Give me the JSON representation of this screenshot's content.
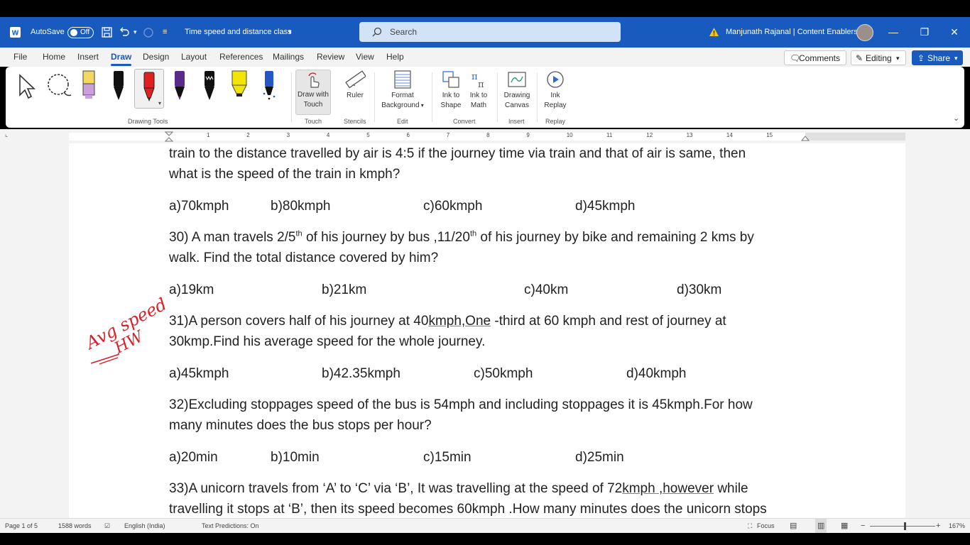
{
  "titlebar": {
    "autosave_label": "AutoSave",
    "autosave_state": "Off",
    "doc_title": "Time speed and distance class",
    "search_placeholder": "Search",
    "user_name": "Manjunath Rajanal | Content Enablers"
  },
  "menu": {
    "tabs": [
      "File",
      "Home",
      "Insert",
      "Draw",
      "Design",
      "Layout",
      "References",
      "Mailings",
      "Review",
      "View",
      "Help"
    ],
    "active": "Draw",
    "comments": "Comments",
    "editing": "Editing",
    "share": "Share"
  },
  "ribbon": {
    "groups": {
      "drawing_tools": "Drawing Tools",
      "touch": "Touch",
      "stencils": "Stencils",
      "edit": "Edit",
      "convert": "Convert",
      "insert": "Insert",
      "replay": "Replay"
    },
    "commands": {
      "draw_with_touch": [
        "Draw with",
        "Touch"
      ],
      "ruler": "Ruler",
      "format_background": [
        "Format",
        "Background"
      ],
      "ink_to_shape": [
        "Ink to",
        "Shape"
      ],
      "ink_to_math": [
        "Ink to",
        "Math"
      ],
      "drawing_canvas": [
        "Drawing",
        "Canvas"
      ],
      "ink_replay": [
        "Ink",
        "Replay"
      ]
    },
    "pens": [
      {
        "name": "highlighter-pink",
        "color": "#c9a0dc"
      },
      {
        "name": "pen-black-1",
        "color": "#111111"
      },
      {
        "name": "pen-red",
        "color": "#e02020"
      },
      {
        "name": "pen-purple",
        "color": "#5a2a8a"
      },
      {
        "name": "pen-black-2",
        "color": "#111111"
      },
      {
        "name": "highlighter-yellow",
        "color": "#f2e600"
      },
      {
        "name": "pen-blue-galaxy",
        "color": "#2456c8"
      }
    ]
  },
  "ruler": {
    "numbers": [
      "1",
      "2",
      "3",
      "4",
      "5",
      "6",
      "7",
      "8",
      "9",
      "10",
      "11",
      "12",
      "13",
      "14",
      "15"
    ]
  },
  "document": {
    "q29": {
      "line1": "train to the distance travelled by air is 4:5 if the journey time via train and that of air is same, then",
      "line2": "what is the speed of the train in kmph?",
      "options": [
        "a)70kmph",
        "b)80kmph",
        "c)60kmph",
        "d)45kmph"
      ]
    },
    "q30": {
      "line1_a": "30) A man travels 2/5",
      "line1_sup1": "th",
      "line1_b": " of his journey by bus ,11/20",
      "line1_sup2": "th",
      "line1_c": " of his journey by bike and remaining 2 kms by",
      "line2": "walk. Find the total distance covered by him?",
      "options": [
        "a)19km",
        "b)21km",
        "c)40km",
        "d)30km"
      ]
    },
    "q31": {
      "line1_a": "31)A person covers half of his journey at 40",
      "line1_u": "kmph,One",
      "line1_b": " -third at 60 kmph and rest of journey at",
      "line2": "30kmp.Find his average speed for the whole journey.",
      "options": [
        "a)45kmph",
        "b)42.35kmph",
        "c)50kmph",
        "d)40kmph"
      ]
    },
    "q32": {
      "line1": "32)Excluding stoppages speed of the bus is 54mph and including stoppages it is 45kmph.For how",
      "line2": "many minutes does the bus stops per hour?",
      "options": [
        "a)20min",
        "b)10min",
        "c)15min",
        "d)25min"
      ]
    },
    "q33": {
      "line1_a": "33)A unicorn travels from ‘A’ to ‘C’ via ‘B’, It was travelling at the speed of 72",
      "line1_u": "kmph ,however",
      "line1_b": " while",
      "line2": "travelling it stops at ‘B’, then its speed becomes 60kmph .How many minutes does the unicorn stops"
    },
    "annotation": {
      "text": "Avg speed",
      "sub": "HW",
      "color": "#d8202a"
    }
  },
  "statusbar": {
    "page": "Page 1 of 5",
    "words": "1588 words",
    "language": "English (India)",
    "text_predictions": "Text Predictions: On",
    "focus": "Focus",
    "zoom": "167%"
  }
}
